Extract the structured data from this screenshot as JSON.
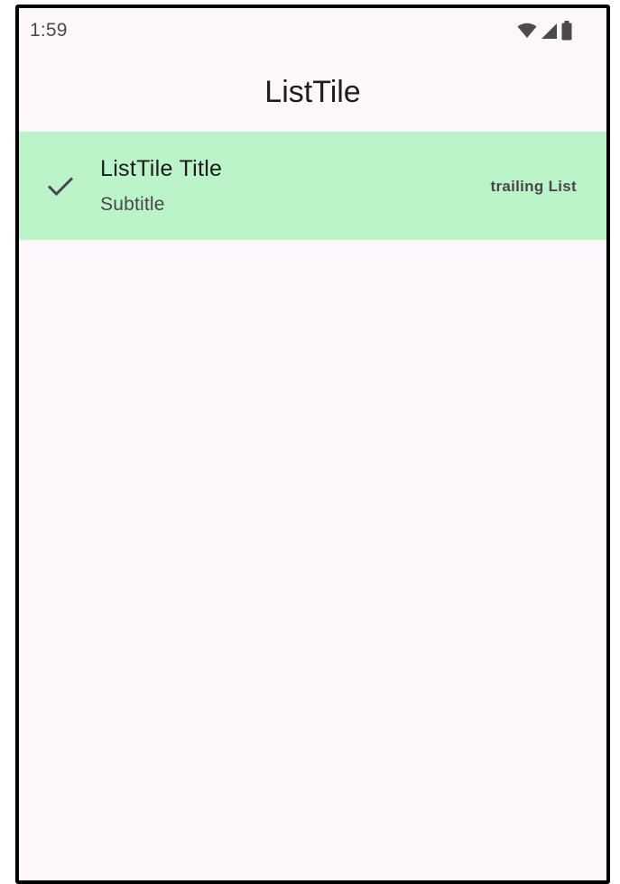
{
  "status_bar": {
    "time": "1:59",
    "icons": [
      "wifi-icon",
      "cell-signal-icon",
      "battery-icon"
    ]
  },
  "app_bar": {
    "title": "ListTile"
  },
  "list_tile": {
    "leading_icon": "check-icon",
    "title": "ListTile Title",
    "subtitle": "Subtitle",
    "trailing": "trailing List",
    "background_color": "#baf4c8"
  },
  "colors": {
    "surface": "#fdf7fc",
    "tile": "#baf4c8",
    "text_primary": "#1f1b1f",
    "text_secondary": "#4c454c"
  }
}
